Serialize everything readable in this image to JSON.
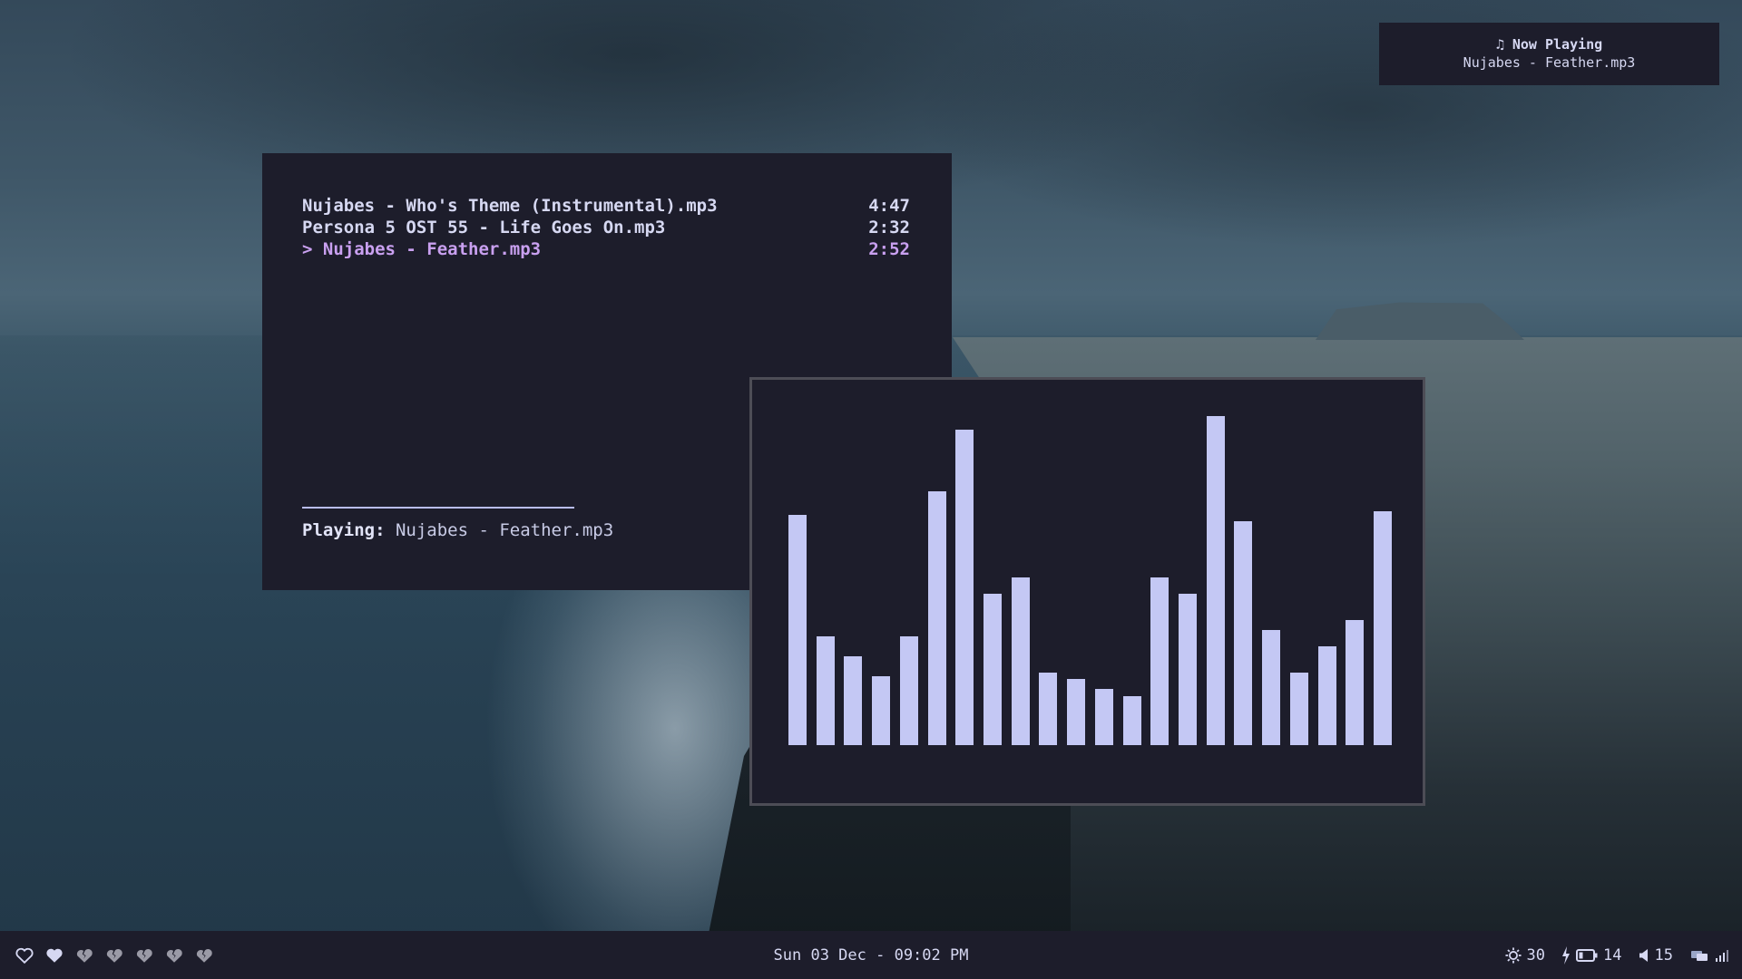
{
  "playlist": {
    "tracks": [
      {
        "title": "Nujabes - Who's Theme (Instrumental).mp3",
        "duration": "4:47"
      },
      {
        "title": "Persona 5 OST 55 - Life Goes On.mp3",
        "duration": "2:32"
      },
      {
        "title": "> Nujabes - Feather.mp3",
        "duration": "2:52"
      }
    ],
    "active_track": 2,
    "now_playing_label": "Playing:",
    "now_playing_value": "Nujabes - Feather.mp3"
  },
  "visualizer": {
    "bar_color": "#c4c8f4",
    "levels": [
      0.7,
      0.33,
      0.27,
      0.21,
      0.33,
      0.77,
      0.96,
      0.46,
      0.51,
      0.22,
      0.2,
      0.17,
      0.15,
      0.51,
      0.46,
      1.0,
      0.68,
      0.35,
      0.22,
      0.3,
      0.38,
      0.71
    ]
  },
  "notification": {
    "icon": "music-note-icon",
    "title": "♫ Now Playing",
    "body": "Nujabes - Feather.mp3"
  },
  "statusbar": {
    "workspaces": [
      {
        "icon": "heart-outline-icon",
        "state": "empty"
      },
      {
        "icon": "heart-filled-icon",
        "state": "active"
      },
      {
        "icon": "broken-heart-icon",
        "state": "occupied"
      },
      {
        "icon": "broken-heart-icon",
        "state": "occupied"
      },
      {
        "icon": "broken-heart-icon",
        "state": "occupied"
      },
      {
        "icon": "broken-heart-icon",
        "state": "occupied"
      },
      {
        "icon": "broken-heart-icon",
        "state": "occupied"
      }
    ],
    "clock": "Sun 03 Dec - 09:02 PM",
    "brightness": "30",
    "battery": "14",
    "volume": "15",
    "icons": {
      "brightness": "brightness-icon",
      "battery": "charging-battery-icon",
      "volume": "volume-icon",
      "tray": "network-tray-icon",
      "signal": "signal-bars-icon"
    }
  },
  "colors": {
    "window_bg": "#1d1d2b",
    "text": "#d6d8f2",
    "accent": "#c9a0f0",
    "visualizer_border": "#4d4d56"
  }
}
